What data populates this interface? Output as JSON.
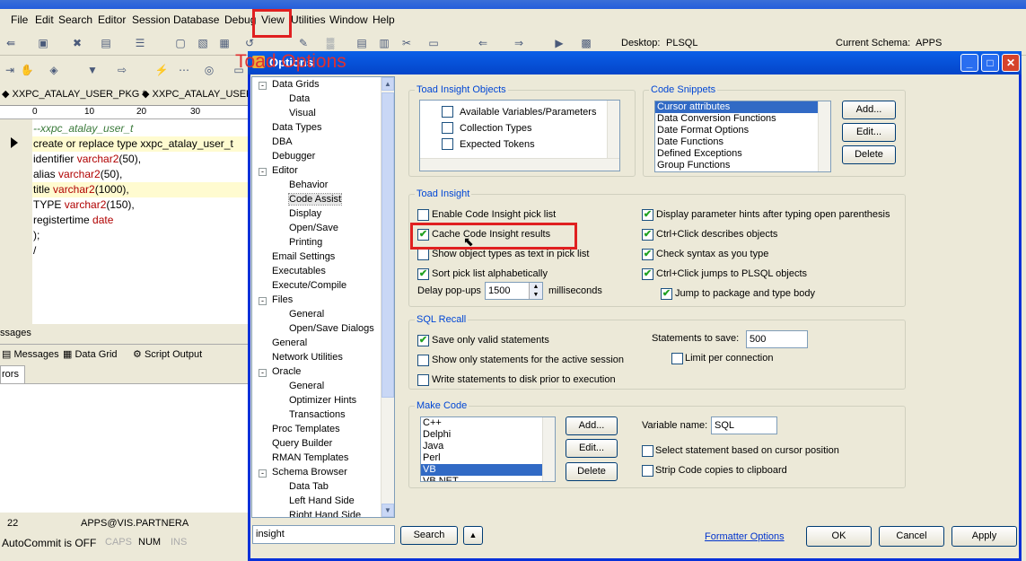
{
  "menu": [
    "File",
    "Edit",
    "Search",
    "Editor",
    "Session",
    "Database",
    "Debug",
    "View",
    "Utilities",
    "Window",
    "Help"
  ],
  "toolbar": {
    "desktop_label": "Desktop:",
    "desktop_value": "PLSQL",
    "schema_label": "Current Schema:",
    "schema_value": "APPS"
  },
  "doc_tabs": [
    "XXPC_ATALAY_USER_PKG *",
    "XXPC_ATALAY_USER_P"
  ],
  "ruler": [
    "0",
    "10",
    "20",
    "30"
  ],
  "code": [
    {
      "t": "--xxpc_atalay_user_t",
      "c": "#3a7a3a"
    },
    {
      "t": "create or replace type xxpc_atalay_user_t",
      "c": "#000"
    },
    {
      "t": "identifier varchar2(50),",
      "c": "#000"
    },
    {
      "t": "alias varchar2(50),",
      "c": "#000"
    },
    {
      "t": "title varchar2(1000),",
      "c": "#000"
    },
    {
      "t": "TYPE varchar2(150),",
      "c": "#000"
    },
    {
      "t": "registertime date",
      "c": "#000"
    },
    {
      "t": ");",
      "c": "#000"
    },
    {
      "t": "/",
      "c": "#000"
    }
  ],
  "messages": {
    "header": "ssages",
    "tabs": [
      "Messages",
      "Data Grid",
      "Script Output"
    ],
    "errors_tab": "rors"
  },
  "status": {
    "line": "22",
    "conn": "APPS@VIS.PARTNERA",
    "autocommit": "AutoCommit is OFF",
    "caps": "CAPS",
    "num": "NUM",
    "ins": "INS"
  },
  "annotation": "Toad Options",
  "dialog": {
    "title": "Options",
    "tree": [
      {
        "label": "Data Grids",
        "level": 0,
        "exp": "-"
      },
      {
        "label": "Data",
        "level": 1
      },
      {
        "label": "Visual",
        "level": 1
      },
      {
        "label": "Data Types",
        "level": 0
      },
      {
        "label": "DBA",
        "level": 0
      },
      {
        "label": "Debugger",
        "level": 0
      },
      {
        "label": "Editor",
        "level": 0,
        "exp": "-"
      },
      {
        "label": "Behavior",
        "level": 1
      },
      {
        "label": "Code Assist",
        "level": 1,
        "selected": true
      },
      {
        "label": "Display",
        "level": 1
      },
      {
        "label": "Open/Save",
        "level": 1
      },
      {
        "label": "Printing",
        "level": 1
      },
      {
        "label": "Email Settings",
        "level": 0
      },
      {
        "label": "Executables",
        "level": 0
      },
      {
        "label": "Execute/Compile",
        "level": 0
      },
      {
        "label": "Files",
        "level": 0,
        "exp": "-"
      },
      {
        "label": "General",
        "level": 1
      },
      {
        "label": "Open/Save Dialogs",
        "level": 1
      },
      {
        "label": "General",
        "level": 0
      },
      {
        "label": "Network Utilities",
        "level": 0
      },
      {
        "label": "Oracle",
        "level": 0,
        "exp": "-"
      },
      {
        "label": "General",
        "level": 1
      },
      {
        "label": "Optimizer Hints",
        "level": 1
      },
      {
        "label": "Transactions",
        "level": 1
      },
      {
        "label": "Proc Templates",
        "level": 0
      },
      {
        "label": "Query Builder",
        "level": 0
      },
      {
        "label": "RMAN Templates",
        "level": 0
      },
      {
        "label": "Schema Browser",
        "level": 0,
        "exp": "-"
      },
      {
        "label": "Data Tab",
        "level": 1
      },
      {
        "label": "Left Hand Side",
        "level": 1
      },
      {
        "label": "Right Hand Side",
        "level": 1
      }
    ],
    "insight_objects": {
      "label": "Toad Insight Objects",
      "items": [
        "Available Variables/Parameters",
        "Collection Types",
        "Expected Tokens"
      ]
    },
    "code_snippets": {
      "label": "Code Snippets",
      "items": [
        "Cursor attributes",
        "Data Conversion Functions",
        "Date Format Options",
        "Date Functions",
        "Defined Exceptions",
        "Group Functions"
      ],
      "add": "Add...",
      "edit": "Edit...",
      "delete": "Delete"
    },
    "toad_insight": {
      "label": "Toad Insight",
      "left": [
        {
          "label": "Enable Code Insight pick list",
          "checked": false
        },
        {
          "label": "Cache Code Insight results",
          "checked": true
        },
        {
          "label": "Show object types as text in pick list",
          "checked": false
        },
        {
          "label": "Sort pick list alphabetically",
          "checked": true
        }
      ],
      "right": [
        {
          "label": "Display parameter hints after typing open parenthesis",
          "checked": true
        },
        {
          "label": "Ctrl+Click describes objects",
          "checked": true
        },
        {
          "label": "Check syntax as you type",
          "checked": true
        },
        {
          "label": "Ctrl+Click jumps to PLSQL objects",
          "checked": true
        },
        {
          "label": "Jump to package and type body",
          "checked": true
        }
      ],
      "delay_label": "Delay pop-ups",
      "delay_value": "1500",
      "delay_unit": "milliseconds"
    },
    "sql_recall": {
      "label": "SQL Recall",
      "items": [
        {
          "label": "Save only valid statements",
          "checked": true
        },
        {
          "label": "Show only statements for the active session",
          "checked": false
        },
        {
          "label": "Write statements to disk prior to execution",
          "checked": false
        }
      ],
      "save_label": "Statements to save:",
      "save_value": "500",
      "limit_label": "Limit per connection",
      "limit_checked": false
    },
    "make_code": {
      "label": "Make Code",
      "items": [
        "C++",
        "Delphi",
        "Java",
        "Perl",
        "VB",
        "VB.NET"
      ],
      "selected": "VB",
      "add": "Add...",
      "edit": "Edit...",
      "delete": "Delete",
      "varname_label": "Variable name:",
      "varname_value": "SQL",
      "opt1": "Select statement based on cursor position",
      "opt2": "Strip Code copies to clipboard"
    },
    "search_value": "insight",
    "search_btn": "Search",
    "formatter_link": "Formatter Options",
    "ok": "OK",
    "cancel": "Cancel",
    "apply": "Apply"
  },
  "colors": {
    "dialog_title": "#0a5fe8",
    "highlight": "#e02020",
    "selection": "#316ac5",
    "group_label": "#0046d5"
  }
}
